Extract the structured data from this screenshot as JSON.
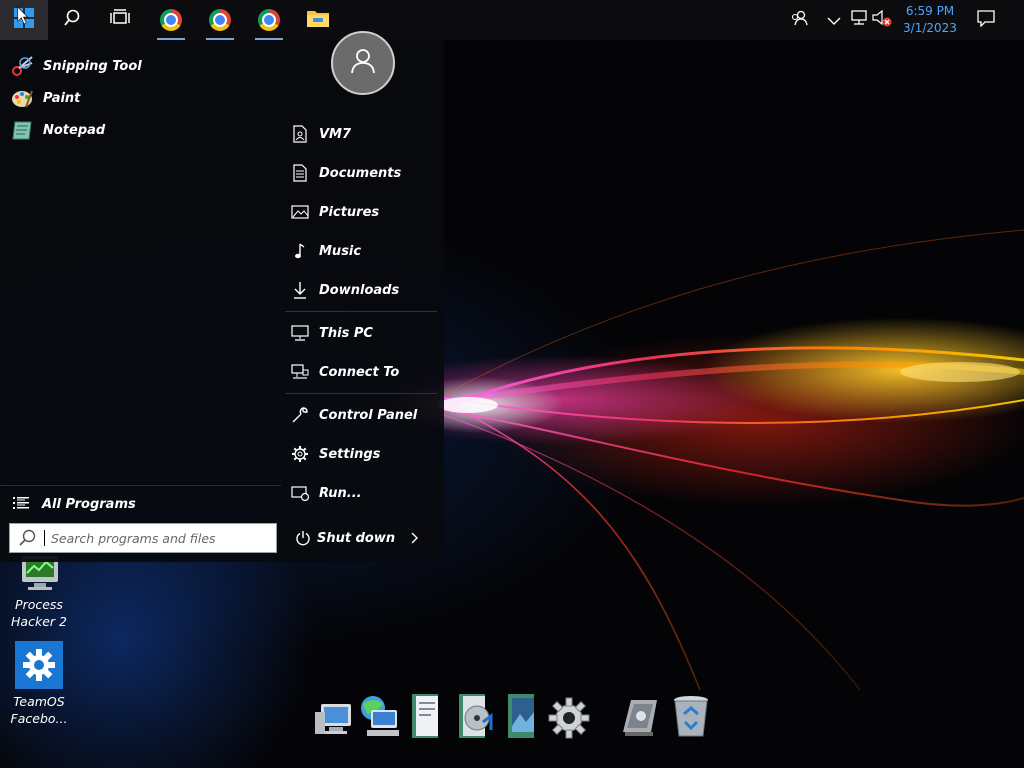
{
  "taskbar": {
    "start_icon": "windows-logo-icon",
    "search_icon": "search-icon",
    "task_view_icon": "task-view-icon",
    "pinned_apps": [
      {
        "icon": "chrome-icon"
      },
      {
        "icon": "chrome-icon"
      },
      {
        "icon": "chrome-icon"
      },
      {
        "icon": "file-explorer-icon"
      }
    ],
    "tray": {
      "icons": [
        "people-icon",
        "chevron-up-icon",
        "network-icon",
        "volume-muted-icon"
      ],
      "time": "6:59 PM",
      "date": "3/1/2023",
      "notification_icon": "action-center-icon"
    }
  },
  "start_menu": {
    "pinned": [
      {
        "label": "Snipping Tool",
        "icon": "snipping-tool-icon"
      },
      {
        "label": "Paint",
        "icon": "paint-icon"
      },
      {
        "label": "Notepad",
        "icon": "notepad-icon"
      }
    ],
    "all_programs_label": "All Programs",
    "search_placeholder": "Search programs and files",
    "user_icon": "user-avatar-icon",
    "right_items": [
      {
        "label": "VM7",
        "icon": "user-folder-icon"
      },
      {
        "label": "Documents",
        "icon": "documents-icon"
      },
      {
        "label": "Pictures",
        "icon": "pictures-icon"
      },
      {
        "label": "Music",
        "icon": "music-icon"
      },
      {
        "label": "Downloads",
        "icon": "downloads-icon"
      },
      {
        "label": "This PC",
        "icon": "computer-icon"
      },
      {
        "label": "Connect To",
        "icon": "connect-to-icon"
      },
      {
        "label": "Control Panel",
        "icon": "wrench-icon"
      },
      {
        "label": "Settings",
        "icon": "gear-icon"
      },
      {
        "label": "Run...",
        "icon": "run-icon"
      }
    ],
    "shutdown_label": "Shut down"
  },
  "desktop_icons": [
    {
      "label": "Process Hacker 2",
      "icon": "process-hacker-icon"
    },
    {
      "label": "TeamOS Facebo...",
      "icon": "settings-gear-icon"
    }
  ],
  "dock": {
    "items": [
      "computer-icon",
      "network-icon",
      "documents-folder-icon",
      "music-folder-icon",
      "pictures-folder-icon",
      "gear-icon",
      "control-panel-icon",
      "recycle-bin-icon"
    ]
  }
}
